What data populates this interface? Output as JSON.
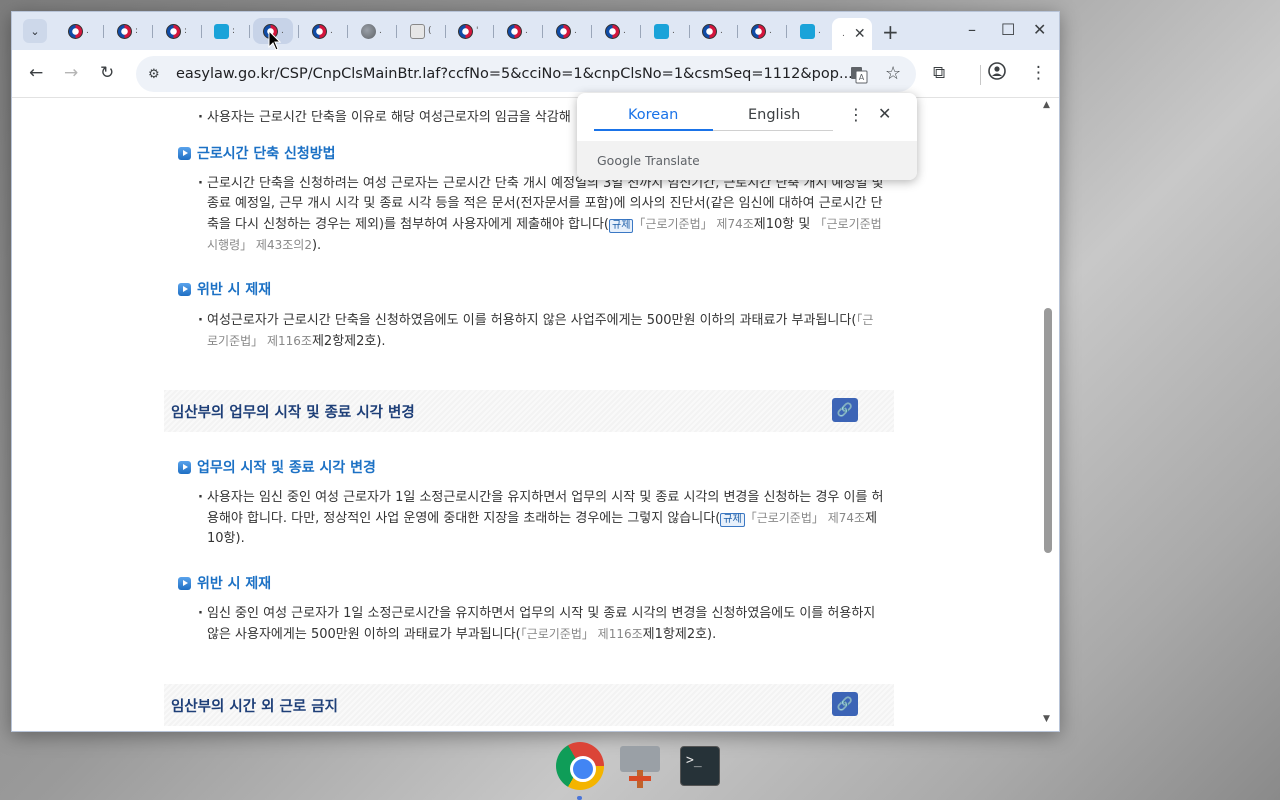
{
  "browser": {
    "url": "easylaw.go.kr/CSP/CnpClsMainBtr.laf?ccfNo=5&cciNo=1&cnpClsNo=1&csmSeq=1112&pop...",
    "tabs": [
      {
        "favicon": "gov",
        "label": "."
      },
      {
        "favicon": "gov",
        "label": ":"
      },
      {
        "favicon": "gov",
        "label": ":"
      },
      {
        "favicon": "law",
        "label": ":"
      },
      {
        "favicon": "gov",
        "label": "."
      },
      {
        "favicon": "gov",
        "label": "."
      },
      {
        "favicon": "globe",
        "label": "."
      },
      {
        "favicon": "misc",
        "label": "("
      },
      {
        "favicon": "gov",
        "label": "'"
      },
      {
        "favicon": "gov",
        "label": "."
      },
      {
        "favicon": "gov",
        "label": "."
      },
      {
        "favicon": "gov",
        "label": "."
      },
      {
        "favicon": "law",
        "label": "."
      },
      {
        "favicon": "gov",
        "label": "."
      },
      {
        "favicon": "gov",
        "label": "."
      },
      {
        "favicon": "law",
        "label": "."
      }
    ],
    "active_tab_label": "."
  },
  "translate_popup": {
    "tab_source": "Korean",
    "tab_target": "English",
    "footer_brand": "Google",
    "footer_text": "Translate"
  },
  "content": {
    "top_fragment": "사용자는 근로시간 단축을 이유로 해당 여성근로자의 임금을 삭감해",
    "s1": {
      "title": "근로시간 단축 신청방법",
      "p_a": "근로시간 단축을 신청하려는 여성 근로자는 근로시간 단축 개시 예정일의 3일 전까지 임신기간, 근로시간 단축 개시 예정일 및 종료 예정일, 근무 개시 시각 및 종료 시각 등을 적은 문서(전자문서를 포함)에 의사의 진단서(같은 임신에 대하여 근로시간 단축을 다시 신청하는 경우는 제외)를 첨부하여 사용자에게 제출해야 합니다(",
      "badge": "규제",
      "law1": "「근로기준법」 제74조",
      "mid1": "제10항 및 ",
      "law2": "「근로기준법 시행령」 제43조의2",
      "end": ")."
    },
    "s2": {
      "title": "위반 시 제재",
      "p_a": "여성근로자가 근로시간 단축을 신청하였음에도 이를 허용하지 않은 사업주에게는 500만원 이하의 과태료가 부과됩니다(",
      "law": "「근로기준법」 제116조",
      "end": "제2항제2호)."
    },
    "section1": {
      "title": "임산부의 업무의 시작 및 종료 시각 변경"
    },
    "s3": {
      "title": "업무의 시작 및 종료 시각 변경",
      "p_a": "사용자는 임신 중인 여성 근로자가 1일 소정근로시간을 유지하면서 업무의 시작 및 종료 시각의 변경을 신청하는 경우 이를 허용해야 합니다. 다만, 정상적인 사업 운영에 중대한 지장을 초래하는 경우에는 그렇지 않습니다(",
      "badge": "규제",
      "law": "「근로기준법」 제74조",
      "end": "제10항)."
    },
    "s4": {
      "title": "위반 시 제재",
      "p_a": "임신 중인 여성 근로자가 1일 소정근로시간을 유지하면서 업무의 시작 및 종료 시각의 변경을 신청하였음에도 이를 허용하지 않은 사용자에게는 500만원 이하의 과태료가 부과됩니다(",
      "law": "「근로기준법」 제116조",
      "end": "제1항제2호)."
    },
    "section2": {
      "title": "임산부의 시간 외 근로 금지"
    }
  },
  "taskbar": {
    "apps": [
      "chrome-icon",
      "tools-icon",
      "terminal-icon"
    ],
    "terminal_glyph": ">_"
  }
}
